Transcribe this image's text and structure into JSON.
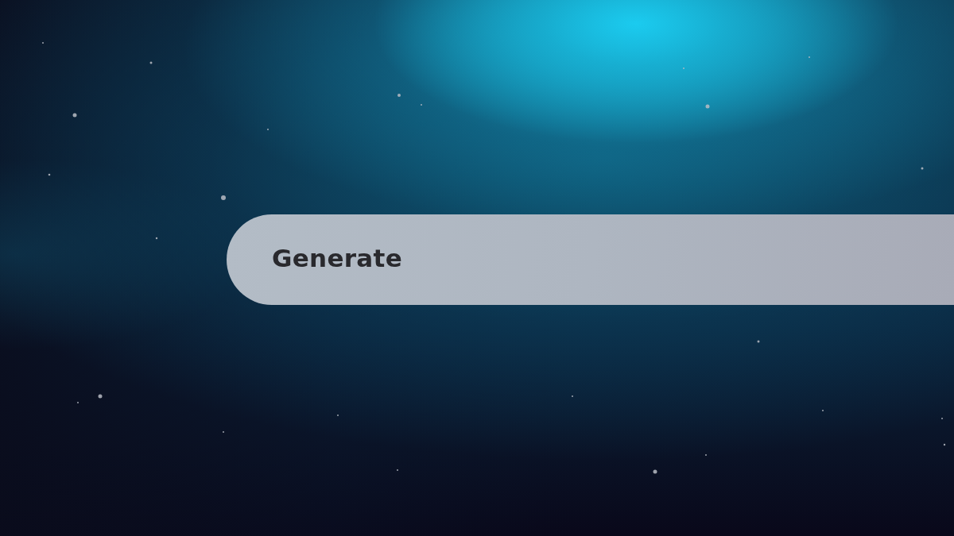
{
  "generate_bar": {
    "label": "Generate"
  }
}
